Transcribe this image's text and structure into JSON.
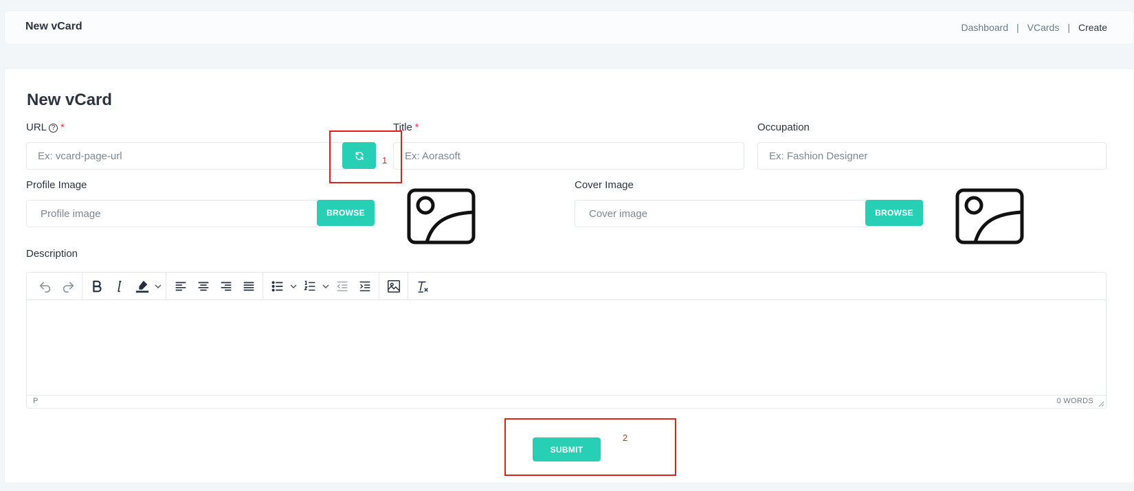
{
  "header": {
    "title": "New vCard",
    "breadcrumb": [
      "Dashboard",
      "VCards",
      "Create"
    ],
    "separator": "|"
  },
  "form": {
    "title": "New vCard",
    "url": {
      "label": "URL",
      "required_mark": "*",
      "help_icon": "question-circle-icon",
      "placeholder": "Ex: vcard-page-url",
      "value": ""
    },
    "generate_button": {
      "icon": "refresh-icon"
    },
    "title_field": {
      "label": "Title",
      "required_mark": "*",
      "placeholder": "Ex: Aorasoft",
      "value": ""
    },
    "occupation": {
      "label": "Occupation",
      "placeholder": "Ex: Fashion Designer",
      "value": ""
    },
    "profile_image": {
      "label": "Profile Image",
      "placeholder": "Profile image",
      "browse_label": "BROWSE",
      "preview_icon": "image-placeholder-icon"
    },
    "cover_image": {
      "label": "Cover Image",
      "placeholder": "Cover image",
      "browse_label": "BROWSE",
      "preview_icon": "image-placeholder-icon"
    },
    "description": {
      "label": "Description",
      "toolbar": [
        "undo-icon",
        "redo-icon",
        "bold-icon",
        "italic-icon",
        "highlight-icon",
        "align-left-icon",
        "align-center-icon",
        "align-right-icon",
        "align-justify-icon",
        "bullet-list-icon",
        "numbered-list-icon",
        "outdent-icon",
        "indent-icon",
        "image-icon",
        "clear-format-icon"
      ],
      "status_path": "P",
      "word_count": "0 WORDS"
    },
    "submit_label": "SUBMIT"
  },
  "annotations": [
    {
      "number": "1"
    },
    {
      "number": "2"
    }
  ],
  "colors": {
    "accent": "#27d0b5",
    "annotation": "#e01e1e",
    "required": "#e53935"
  }
}
